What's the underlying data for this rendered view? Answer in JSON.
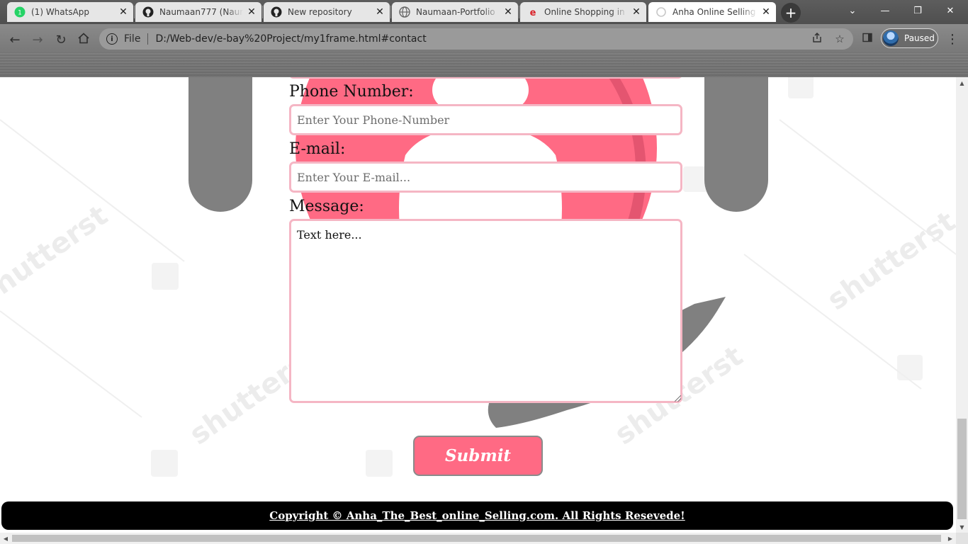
{
  "browser": {
    "tabs": [
      {
        "title": "(1) WhatsApp",
        "icon": "whatsapp-icon"
      },
      {
        "title": "Naumaan777 (Naum",
        "icon": "github-icon"
      },
      {
        "title": "New repository",
        "icon": "github-icon"
      },
      {
        "title": "Naumaan-Portfolio",
        "icon": "globe-icon"
      },
      {
        "title": "Online Shopping in P",
        "icon": "ebay-icon"
      },
      {
        "title": "Anha Online Selling A",
        "icon": "loading-icon",
        "active": true
      }
    ],
    "address": {
      "scheme_label": "File",
      "url": "D:/Web-dev/e-bay%20Project/my1frame.html#contact"
    },
    "profile_status": "Paused"
  },
  "form": {
    "phone": {
      "label": "Phone Number:",
      "placeholder": "Enter Your Phone-Number"
    },
    "email": {
      "label": "E-mail:",
      "placeholder": "Enter Your E-mail..."
    },
    "message": {
      "label": "Message:",
      "placeholder": "Text here..."
    },
    "submit_label": "Submit"
  },
  "footer": {
    "copyright": "Copyright © Anha_The_Best_online_Selling.com. All Rights Resevede!"
  },
  "colors": {
    "accent": "#ff6a84",
    "input_border": "#f5b6c4",
    "footer_bg": "#000000"
  }
}
